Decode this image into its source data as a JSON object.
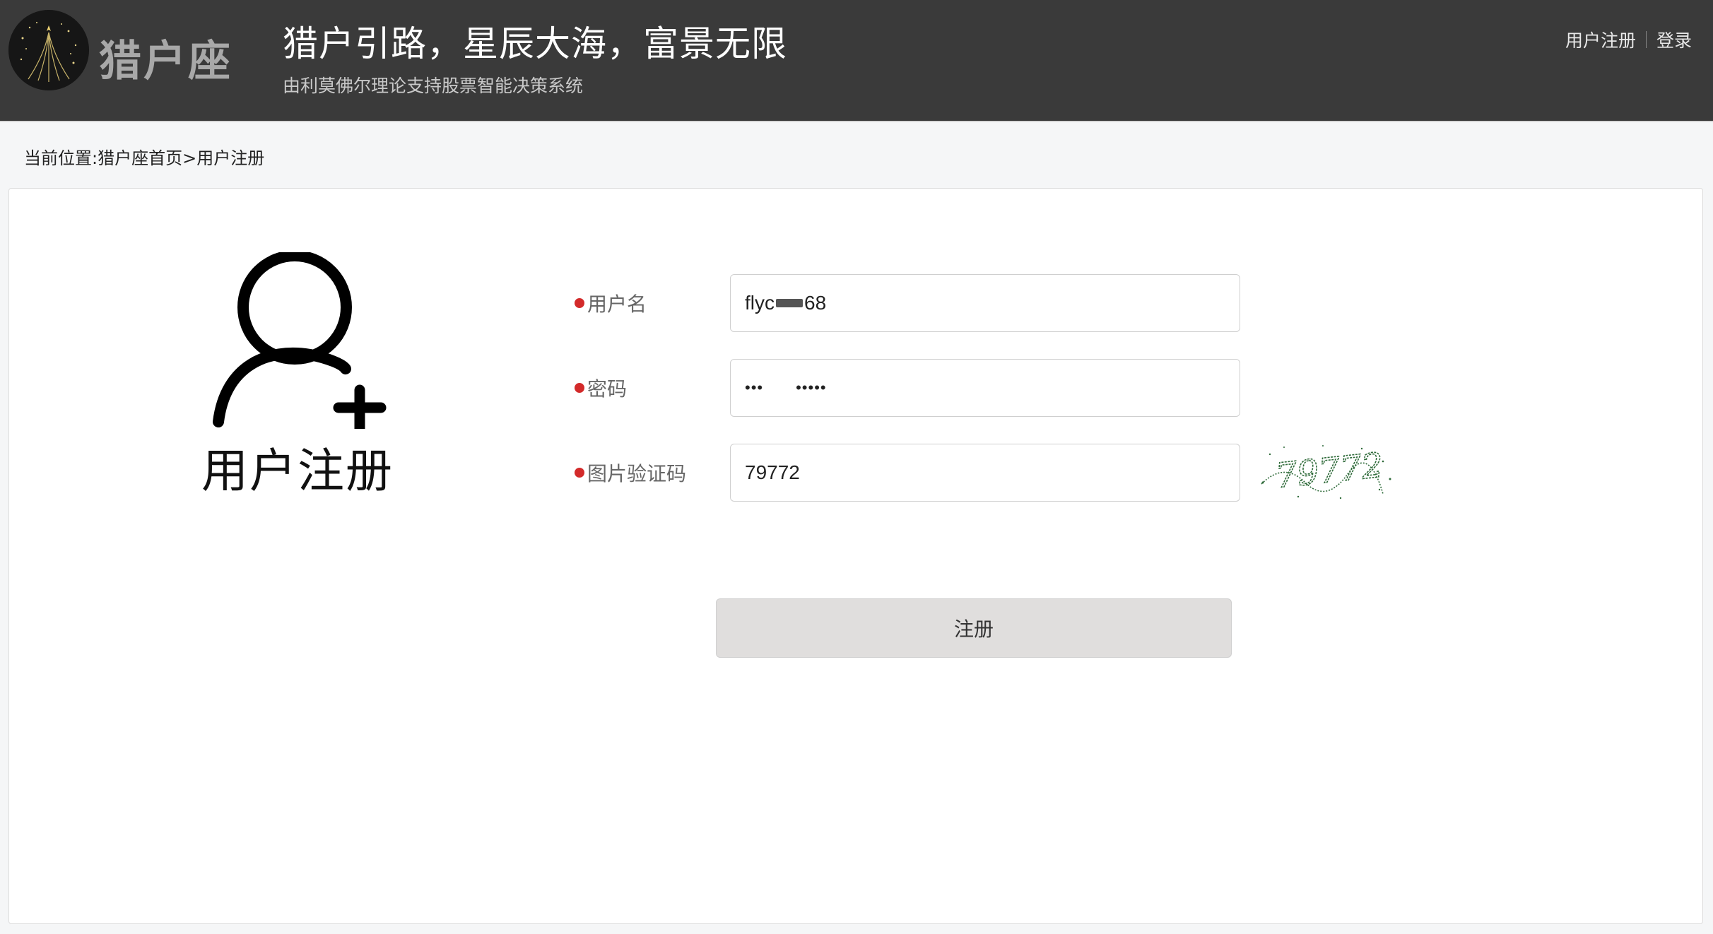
{
  "header": {
    "logo_text": "猎户座",
    "slogan": "猎户引路，星辰大海，富景无限",
    "subslogan": "由利莫佛尔理论支持股票智能决策系统",
    "links": {
      "register": "用户注册",
      "login": "登录"
    }
  },
  "breadcrumb": {
    "prefix": "当前位置:",
    "home": "猎户座首页",
    "separator": ">",
    "current": "用户注册"
  },
  "register_panel": {
    "icon": "user-plus-icon",
    "title": "用户注册"
  },
  "form": {
    "username": {
      "label": "用户名",
      "value_start": "flyc",
      "value_end": "68"
    },
    "password": {
      "label": "密码",
      "value_start": "•••",
      "value_end": "•••••"
    },
    "captcha": {
      "label": "图片验证码",
      "value": "79772",
      "image_text": "79772"
    },
    "submit_label": "注册"
  },
  "colors": {
    "header_bg": "#3a3a3a",
    "required_dot": "#d32a2a",
    "button_bg": "#e0dedd"
  }
}
